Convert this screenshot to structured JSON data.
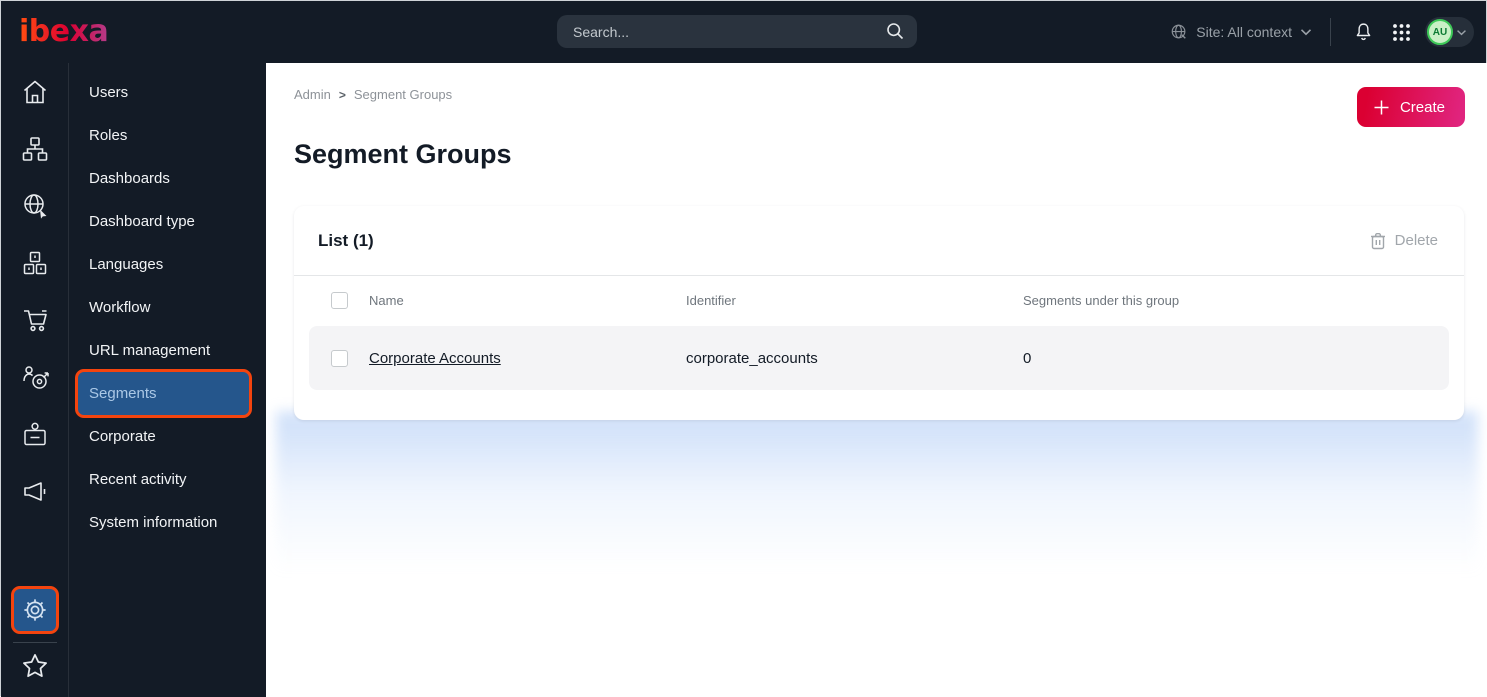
{
  "topbar": {
    "logo": "ibexa",
    "search_placeholder": "Search...",
    "site_context_label": "Site: All context",
    "avatar_initials": "AU"
  },
  "menu": {
    "items": [
      {
        "label": "Users",
        "active": false
      },
      {
        "label": "Roles",
        "active": false
      },
      {
        "label": "Dashboards",
        "active": false
      },
      {
        "label": "Dashboard type",
        "active": false
      },
      {
        "label": "Languages",
        "active": false
      },
      {
        "label": "Workflow",
        "active": false
      },
      {
        "label": "URL management",
        "active": false
      },
      {
        "label": "Segments",
        "active": true
      },
      {
        "label": "Corporate",
        "active": false
      },
      {
        "label": "Recent activity",
        "active": false
      },
      {
        "label": "System information",
        "active": false
      }
    ]
  },
  "breadcrumb": {
    "items": [
      "Admin",
      "Segment Groups"
    ],
    "separator": ">"
  },
  "page": {
    "title": "Segment Groups",
    "create_label": "Create"
  },
  "list_card": {
    "title": "List (1)",
    "delete_label": "Delete",
    "columns": [
      "Name",
      "Identifier",
      "Segments under this group"
    ],
    "rows": [
      {
        "name": "Corporate Accounts",
        "identifier": "corporate_accounts",
        "segments_count": "0"
      }
    ]
  },
  "colors": {
    "accent_red": "#db0032",
    "highlight_orange": "#f4440e",
    "active_blue": "#25568c",
    "topbar_dark": "#131b26",
    "avatar_green": "#3ec958"
  },
  "icons": {
    "rail": [
      "home-icon",
      "content-structure-icon",
      "site-globe-icon",
      "products-boxes-icon",
      "commerce-cart-icon",
      "personalization-target-icon",
      "corporate-badge-icon",
      "activity-megaphone-icon",
      "settings-gear-icon",
      "bookmarks-star-icon"
    ],
    "topbar": [
      "search-icon",
      "site-context-globe-icon",
      "chevron-down-icon",
      "notifications-bell-icon",
      "app-grid-icon",
      "avatar"
    ],
    "card": [
      "trash-icon",
      "checkbox",
      "plus-icon"
    ]
  }
}
